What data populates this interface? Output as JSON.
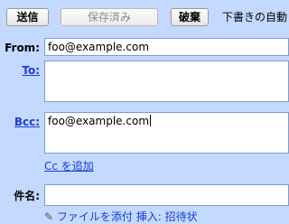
{
  "toolbar": {
    "send_label": "送信",
    "save_label": "保存済み",
    "discard_label": "破棄",
    "draft_status": "下書きの自動"
  },
  "compose": {
    "from_label": "From:",
    "from_value": "foo@example.com",
    "to_label": "To:",
    "to_value": "",
    "bcc_label": "Bcc:",
    "bcc_value": "foo@example.com",
    "add_cc_label": "Cc を追加",
    "subject_label": "件名:",
    "subject_value": "",
    "attach_text": "ファイルを添付  挿入: 招待状"
  },
  "icons": {
    "attach": "paperclip-icon"
  },
  "colors": {
    "background": "#c3d9ff",
    "link": "#1a3ecf",
    "field_border": "#7b9bd1"
  }
}
